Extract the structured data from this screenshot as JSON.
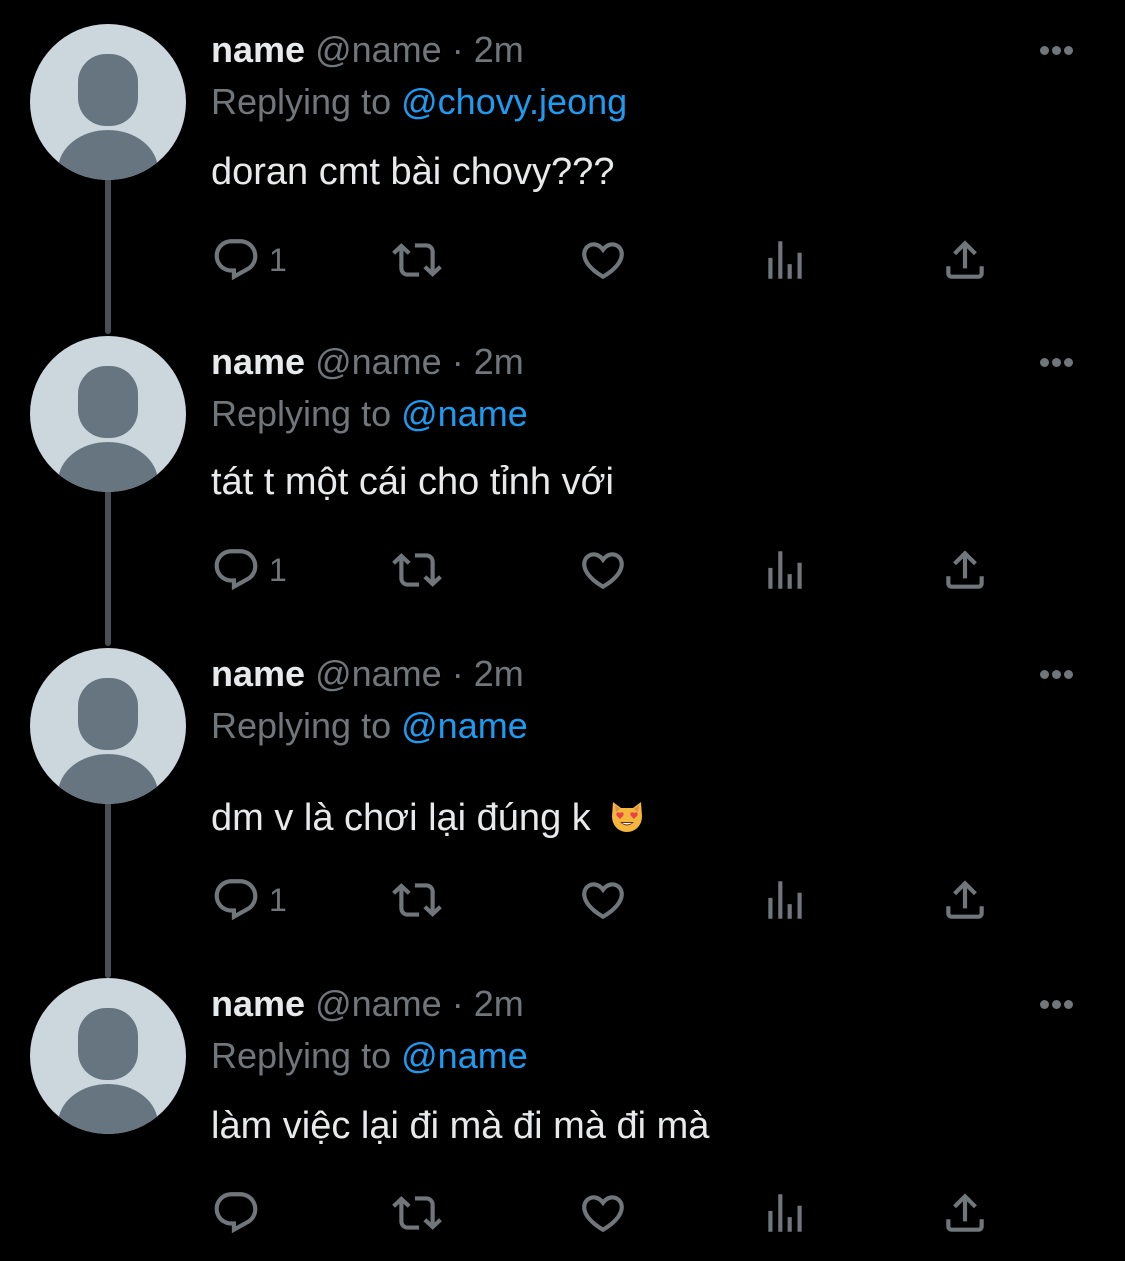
{
  "tweets": [
    {
      "display_name": "name",
      "handle": "@name",
      "separator": "·",
      "time": "2m",
      "replying_prefix": "Replying to",
      "replying_to": "@chovy.jeong",
      "text": "doran cmt bài chovy???",
      "reply_count": "1",
      "emoji": ""
    },
    {
      "display_name": "name",
      "handle": "@name",
      "separator": "·",
      "time": "2m",
      "replying_prefix": "Replying to",
      "replying_to": "@name",
      "text": "tát t một cái cho tỉnh với",
      "reply_count": "1",
      "emoji": ""
    },
    {
      "display_name": "name",
      "handle": "@name",
      "separator": "·",
      "time": "2m",
      "replying_prefix": "Replying to",
      "replying_to": "@name",
      "text": "dm v là chơi lại đúng k",
      "reply_count": "1",
      "emoji": "heart-eyes-cat"
    },
    {
      "display_name": "name",
      "handle": "@name",
      "separator": "·",
      "time": "2m",
      "replying_prefix": "Replying to",
      "replying_to": "@name",
      "text": "làm việc lại đi mà đi mà đi mà",
      "reply_count": "",
      "emoji": ""
    }
  ],
  "icons": {
    "reply": "reply-icon",
    "retweet": "retweet-icon",
    "like": "heart-icon",
    "views": "views-icon",
    "share": "share-icon",
    "more": "more-icon"
  },
  "colors": {
    "background": "#000000",
    "primary_text": "#e7e9ea",
    "secondary_text": "#71767b",
    "accent": "#1d9bf0",
    "thread_line": "#4a4f55"
  }
}
